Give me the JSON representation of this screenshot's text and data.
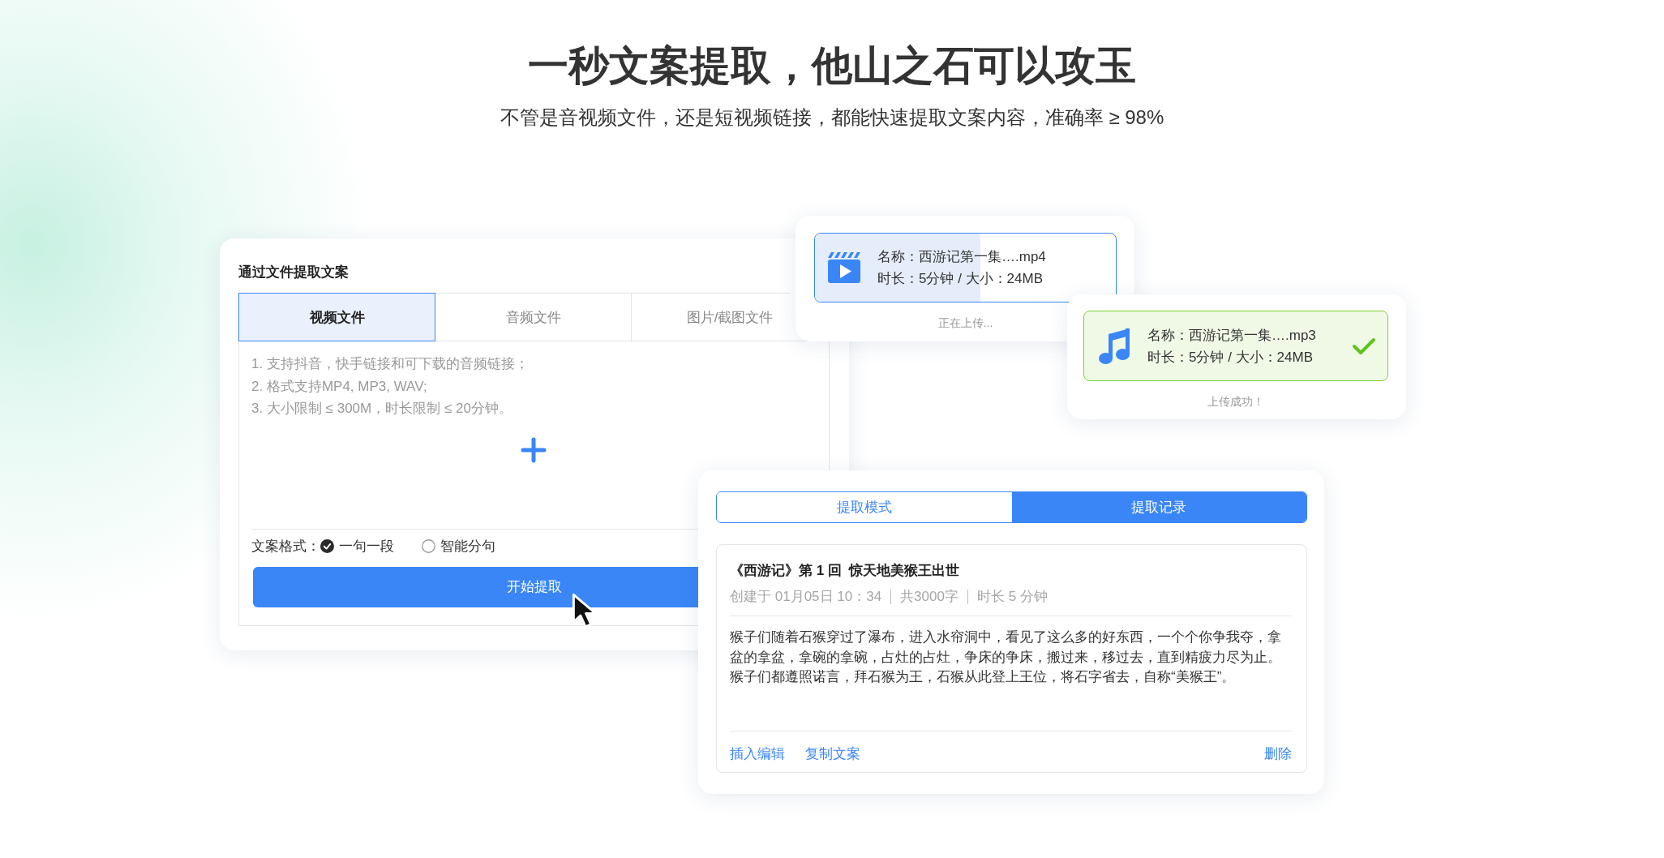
{
  "header": {
    "title": "一秒文案提取，他山之石可以攻玉",
    "subtitle": "不管是音视频文件，还是短视频链接，都能快速提取文案内容，准确率 ≥ 98%"
  },
  "file_panel": {
    "heading": "通过文件提取文案",
    "tabs": [
      {
        "label": "视频文件",
        "selected": true
      },
      {
        "label": "音频文件",
        "selected": false
      },
      {
        "label": "图片/截图文件",
        "selected": false
      }
    ],
    "hints": [
      "1. 支持抖音，快手链接和可下载的音频链接；",
      "2. 格式支持MP4, MP3, WAV;",
      "3. 大小限制 ≤ 300M，时长限制 ≤ 20分钟。"
    ],
    "format": {
      "label": "文案格式：",
      "options": [
        {
          "label": "一句一段",
          "selected": true
        },
        {
          "label": "智能分句",
          "selected": false
        }
      ]
    },
    "button": "开始提取"
  },
  "uploads": [
    {
      "kind": "video",
      "name": "名称：西游记第一集….mp4",
      "info": "时长：5分钟 / 大小：24MB",
      "status": "正在上传...",
      "level": 0.55,
      "done": false
    },
    {
      "kind": "audio",
      "name": "名称：西游记第一集….mp3",
      "info": "时长：5分钟 / 大小：24MB",
      "status": "上传成功！",
      "done": true
    }
  ],
  "results": {
    "tabs": [
      {
        "label": "提取模式",
        "selected": false
      },
      {
        "label": "提取记录",
        "selected": true
      }
    ],
    "record": {
      "title": "《西游记》第 1 回  惊天地美猴王出世",
      "meta": [
        "创建于 01月05日 10：34",
        "共3000字",
        "时长 5 分钟"
      ],
      "body": "猴子们随着石猴穿过了瀑布，进入水帘洞中，看见了这么多的好东西，一个个你争我夺，拿盆的拿盆，拿碗的拿碗，占灶的占灶，争床的争床，搬过来，移过去，直到精疲力尽为止。猴子们都遵照诺言，拜石猴为王，石猴从此登上王位，将石字省去，自称“美猴王”。",
      "actions": [
        "插入编辑",
        "复制文案"
      ],
      "delete": "删除"
    }
  }
}
